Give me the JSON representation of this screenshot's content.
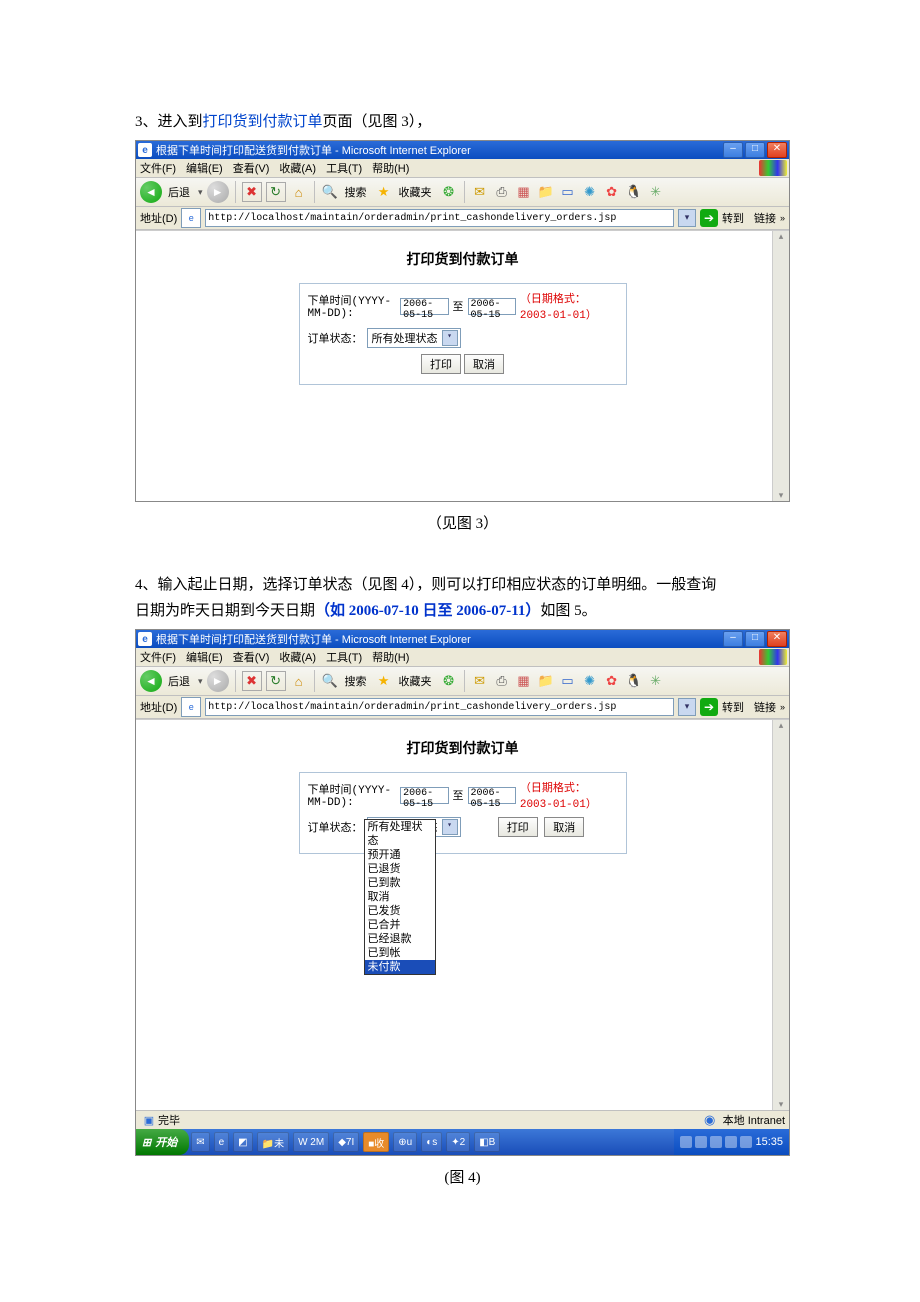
{
  "section3": {
    "text_prefix": "3、进入到",
    "link": "打印货到付款订单",
    "text_suffix": "页面（见图 3），"
  },
  "fig3": {
    "titlebar": "根据下单时间打印配送货到付款订单 - Microsoft Internet Explorer",
    "menus": [
      "文件(F)",
      "编辑(E)",
      "查看(V)",
      "收藏(A)",
      "工具(T)",
      "帮助(H)"
    ],
    "toolbar": {
      "back": "后退",
      "search": "搜索",
      "fav": "收藏夹"
    },
    "address_label": "地址(D)",
    "address_url": "http://localhost/maintain/orderadmin/print_cashondelivery_orders.jsp",
    "go_label": "转到",
    "links_label": "链接",
    "page_title": "打印货到付款订单",
    "form": {
      "date_label": "下单时间(YYYY-MM-DD):",
      "date_from": "2006-05-15",
      "to": "至",
      "date_to": "2006-05-15",
      "hint": "（日期格式：2003-01-01）",
      "status_label": "订单状态：",
      "status_value": "所有处理状态",
      "btn_print": "打印",
      "btn_cancel": "取消"
    }
  },
  "caption3": "（见图 3）",
  "section4": {
    "line1_a": "4、输入起止日期，选择订单状态（见图 4），则可以打印相应状态的订单明细。一般查询",
    "line2_a": "日期为昨天日期到今天日期",
    "line2_blue": "（如 2006-07-10 日至 2006-07-11）",
    "line2_b": "如图 5。"
  },
  "fig4": {
    "titlebar": "根据下单时间打印配送货到付款订单 - Microsoft Internet Explorer",
    "menus": [
      "文件(F)",
      "编辑(E)",
      "查看(V)",
      "收藏(A)",
      "工具(T)",
      "帮助(H)"
    ],
    "toolbar": {
      "back": "后退",
      "search": "搜索",
      "fav": "收藏夹"
    },
    "address_label": "地址(D)",
    "address_url": "http://localhost/maintain/orderadmin/print_cashondelivery_orders.jsp",
    "go_label": "转到",
    "links_label": "链接",
    "page_title": "打印货到付款订单",
    "form": {
      "date_label": "下单时间(YYYY-MM-DD):",
      "date_from": "2006-05-15",
      "to": "至",
      "date_to": "2006-05-15",
      "hint": "（日期格式：2003-01-01）",
      "status_label": "订单状态：",
      "status_value": "所有处理状态",
      "btn_print": "打印",
      "btn_cancel": "取消"
    },
    "dropdown_options": [
      "所有处理状态",
      "预开通",
      "已退货",
      "已到款",
      "取消",
      "已发货",
      "已合并",
      "已经退款",
      "已到帐",
      "未付款"
    ],
    "dropdown_highlight_index": 9,
    "status_done": "完毕",
    "status_zone": "本地 Intranet",
    "start": "开始",
    "clock": "15:35"
  },
  "caption4": "(图 4)"
}
